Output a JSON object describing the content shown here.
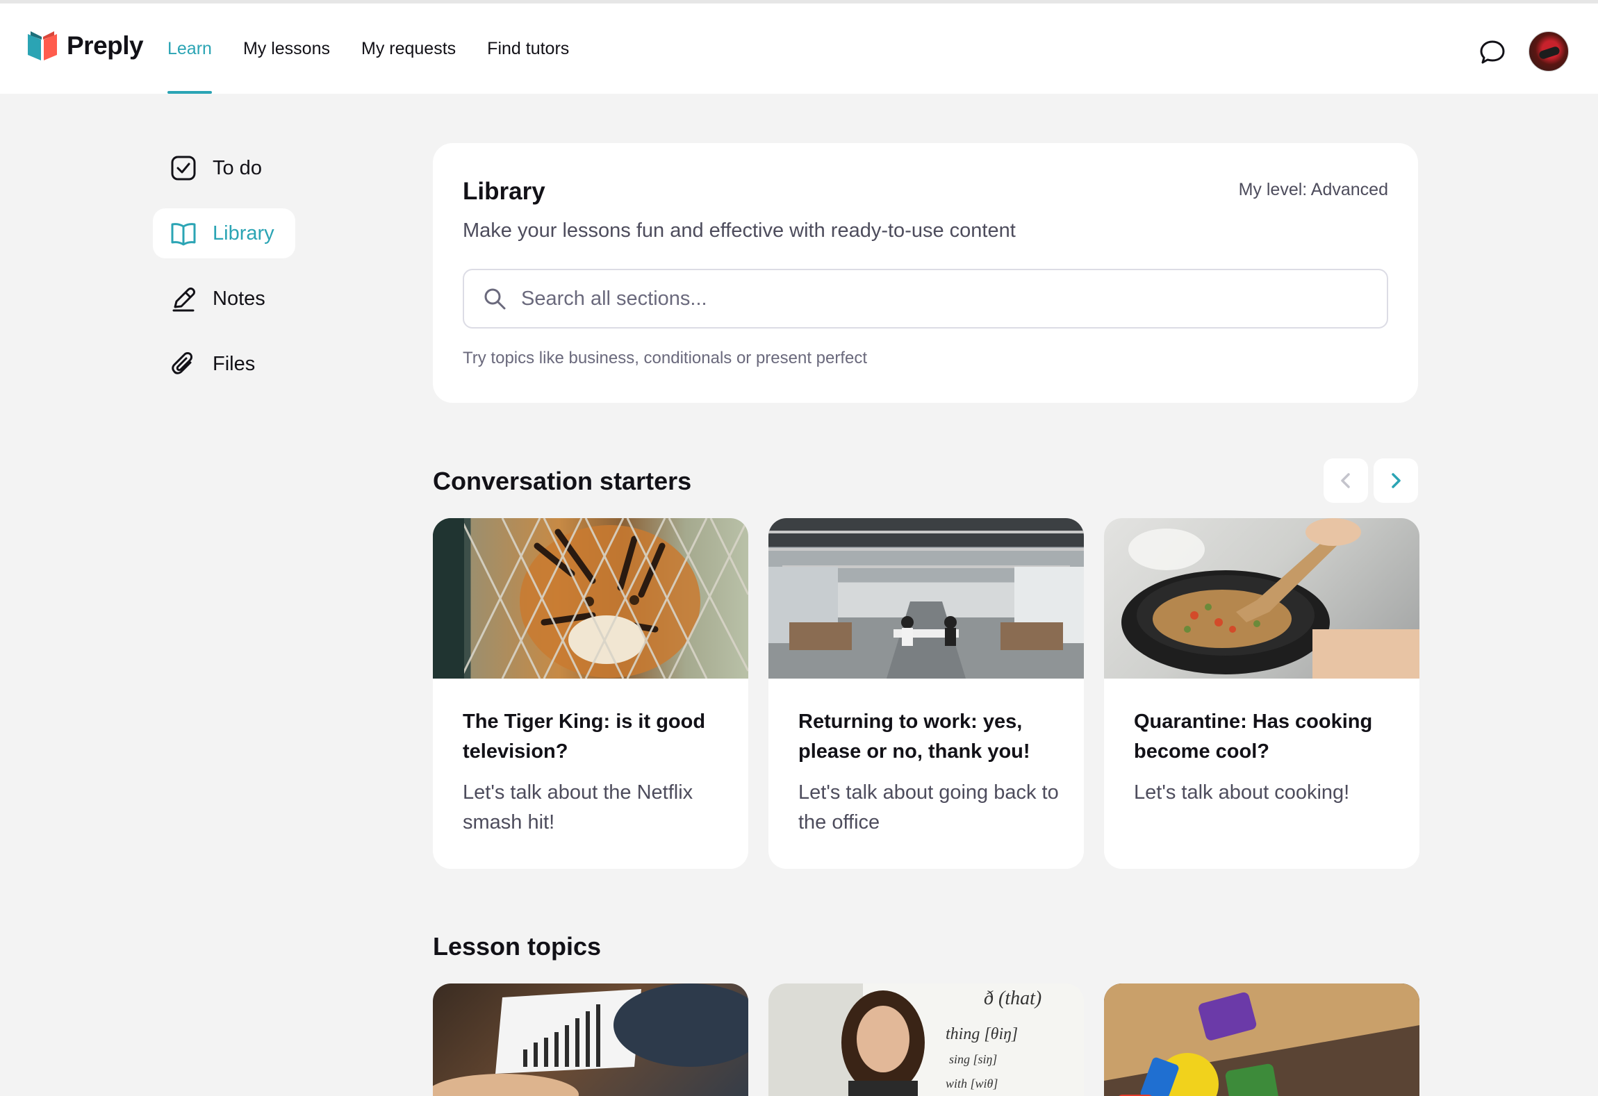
{
  "app": {
    "brand": "Preply"
  },
  "nav": {
    "items": [
      {
        "label": "Learn",
        "active": true
      },
      {
        "label": "My lessons"
      },
      {
        "label": "My requests"
      },
      {
        "label": "Find tutors"
      }
    ],
    "chat_icon": "chat-bubble-icon"
  },
  "sidebar": {
    "items": [
      {
        "label": "To do",
        "icon": "checkbox-icon"
      },
      {
        "label": "Library",
        "icon": "book-icon",
        "active": true
      },
      {
        "label": "Notes",
        "icon": "pen-icon"
      },
      {
        "label": "Files",
        "icon": "paperclip-icon"
      }
    ]
  },
  "library": {
    "title": "Library",
    "level": "My level: Advanced",
    "subtitle": "Make your lessons fun and effective with ready-to-use content",
    "search_placeholder": "Search all sections...",
    "hint": "Try topics like business, conditionals or present perfect"
  },
  "conversation_starters": {
    "title": "Conversation starters",
    "cards": [
      {
        "title": "The Tiger King: is it good television?",
        "description": "Let's talk about the Netflix smash hit!",
        "image": "tiger-behind-fence"
      },
      {
        "title": "Returning to work: yes, please or no, thank you!",
        "description": "Let's talk about going back to the office",
        "image": "open-plan-office"
      },
      {
        "title": "Quarantine: Has cooking become cool?",
        "description": "Let's talk about cooking!",
        "image": "pan-cooking"
      }
    ]
  },
  "lesson_topics": {
    "title": "Lesson topics",
    "cards": [
      {
        "image": "business-chart-meeting"
      },
      {
        "image": "teacher-at-whiteboard"
      },
      {
        "image": "colorful-letter-blocks"
      }
    ]
  },
  "colors": {
    "accent": "#2ba4b4",
    "background": "#f3f3f3",
    "card": "#ffffff",
    "text": "#121117"
  }
}
